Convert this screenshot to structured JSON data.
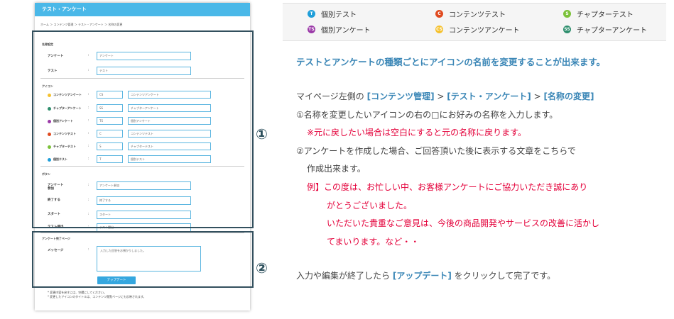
{
  "screen": {
    "title": "テスト・アンケート",
    "breadcrumb": "ホーム ＞ コンテンツ管理 ＞ テスト・アンケート ＞ 名称の変更",
    "sections": {
      "names": "名称設定",
      "icons": "アイコン",
      "buttons": "ボタン",
      "completion": "アンケート完了ページ"
    },
    "name_rows": [
      {
        "label": "アンケート",
        "value": "アンケート"
      },
      {
        "label": "テスト",
        "value": "テスト"
      }
    ],
    "icon_rows": [
      {
        "label": "コンテンツアンケート",
        "abbr": "CS",
        "name": "コンテンツアンケート",
        "color": "#f5c12e"
      },
      {
        "label": "チャプターアンケート",
        "abbr": "SS",
        "name": "チャプターアンケート",
        "color": "#2f8f6e"
      },
      {
        "label": "個別アンケート",
        "abbr": "TS",
        "name": "個別アンケート",
        "color": "#9b3aa8"
      },
      {
        "label": "コンテンツテスト",
        "abbr": "C",
        "name": "コンテンツテスト",
        "color": "#e04a1f"
      },
      {
        "label": "チャプターテスト",
        "abbr": "S",
        "name": "チャプターテスト",
        "color": "#7cc23a"
      },
      {
        "label": "個別テスト",
        "abbr": "T",
        "name": "個別テスト",
        "color": "#1e9ed9"
      }
    ],
    "button_rows": [
      {
        "label": "アンケート\n参加",
        "value": "アンケート参加"
      },
      {
        "label": "終了する",
        "value": "終了する"
      },
      {
        "label": "スタート",
        "value": "スタート"
      },
      {
        "label": "テスト提出",
        "value": "テスト提出"
      }
    ],
    "message_label": "メッセージ",
    "message_value": "入力した回答をお預かりしました。",
    "update_button": "アップデート",
    "notes": [
      "* 変更内容を戻すには、空欄にしてください。",
      "* 変更したアイコンのタイトルは、コンテンツ閲覧ページにも反映されます。"
    ]
  },
  "markers": {
    "one": "①",
    "two": "②"
  },
  "legend": [
    {
      "abbr": "T",
      "label": "個別テスト",
      "color": "#1e9ed9"
    },
    {
      "abbr": "C",
      "label": "コンテンツテスト",
      "color": "#e04a1f"
    },
    {
      "abbr": "S",
      "label": "チャプターテスト",
      "color": "#7cc23a"
    },
    {
      "abbr": "TS",
      "label": "個別アンケート",
      "color": "#9b3aa8"
    },
    {
      "abbr": "CS",
      "label": "コンテンツアンケート",
      "color": "#f5c12e"
    },
    {
      "abbr": "SS",
      "label": "チャプターアンケート",
      "color": "#2f8f6e"
    }
  ],
  "explain": {
    "heading": "テストとアンケートの種類ごとにアイコンの名前を変更することが出来ます。",
    "path_prefix": "マイページ左側の",
    "path_1": "[コンテンツ管理]",
    "sep": " > ",
    "path_2": "[テスト・アンケート]",
    "path_3": "[名称の変更]",
    "step1": "①名称を変更したいアイコンの右の□にお好みの名称を入力します。",
    "step1_note": "※元に戻したい場合は空白にすると元の名称に戻ります。",
    "step2_line1": "②アンケートを作成した場合、ご回答頂いた後に表示する文章をこちらで",
    "step2_line2": "作成出来ます。",
    "example_1": "例】この度は、お忙しい中、お客様アンケートにご協力いただき誠にあり",
    "example_2": "がとうございました。",
    "example_3": "いただいた貴重なご意見は、今後の商品開発やサービスの改善に活かし",
    "example_4": "てまいります。など・・",
    "final_prefix": "入力や編集が終了したら ",
    "final_kw": "[アップデート]",
    "final_suffix": " をクリックして完了です。"
  }
}
